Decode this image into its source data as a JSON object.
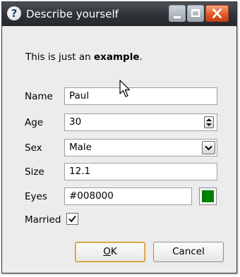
{
  "window": {
    "title": "Describe yourself",
    "title_icon_glyph": "?",
    "colors": {
      "titlebar": "#2f3236",
      "close_button": "#e65a2a",
      "ok_button_border": "#c8892e"
    }
  },
  "intro": {
    "text_plain": "This is just an ",
    "text_bold": "example",
    "text_end": "."
  },
  "form": {
    "name": {
      "label": "Name",
      "value": "Paul"
    },
    "age": {
      "label": "Age",
      "value": "30"
    },
    "sex": {
      "label": "Sex",
      "value": "Male"
    },
    "size": {
      "label": "Size",
      "value": "12.1"
    },
    "eyes": {
      "label": "Eyes",
      "value": "#008000",
      "swatch_color": "#008000"
    },
    "married": {
      "label": "Married",
      "checked": true
    }
  },
  "buttons": {
    "ok_label": "OK",
    "ok_label_rest": "K",
    "ok_mnemonic": "O",
    "cancel_label": "Cancel"
  },
  "icons": {
    "title": "question-mark-icon",
    "minimize": "minimize-icon",
    "maximize": "maximize-icon",
    "close": "close-icon",
    "spin": "spinner-arrows-icon",
    "combo": "chevron-down-icon",
    "check": "checkmark-icon",
    "cursor": "mouse-pointer-icon"
  }
}
